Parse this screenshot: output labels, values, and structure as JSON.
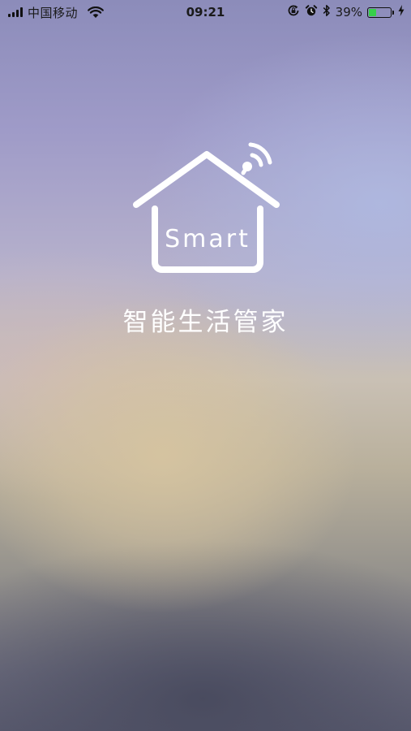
{
  "status_bar": {
    "carrier": "中国移动",
    "time": "09:21",
    "battery_percent": "39%",
    "battery_level": 0.39,
    "signal_bars": 4,
    "icons": [
      "signal-icon",
      "wifi-icon",
      "rotation-lock-icon",
      "alarm-icon",
      "bluetooth-icon",
      "battery-icon",
      "charging-icon"
    ]
  },
  "splash": {
    "logo_text": "Smart",
    "app_title": "智能生活管家",
    "logo_icon": "smart-home-icon"
  },
  "colors": {
    "text_light": "#ffffff",
    "status_text": "#111111",
    "battery_green": "#37d04a"
  }
}
